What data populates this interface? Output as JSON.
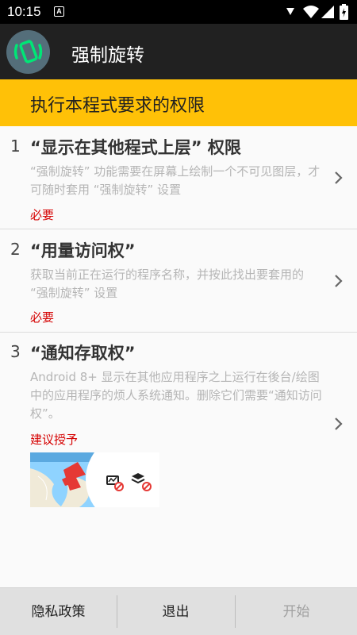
{
  "status_bar": {
    "time": "10:15",
    "notification_letter": "A"
  },
  "app_bar": {
    "title": "强制旋转",
    "icon": "rotate-phone-icon"
  },
  "banner": {
    "text": "执行本程式要求的权限"
  },
  "permissions": [
    {
      "number": "1",
      "title": "“显示在其他程式上层” 权限",
      "description": "“强制旋转” 功能需要在屏幕上绘制一个不可见图层，才可随时套用 “强制旋转” 设置",
      "tag": "必要"
    },
    {
      "number": "2",
      "title": "“用量访问权”",
      "description": "获取当前正在运行的程序名称，并按此找出要套用的 “强制旋转” 设置",
      "tag": "必要"
    },
    {
      "number": "3",
      "title": "“通知存取权”",
      "description": "Android 8+ 显示在其他应用程序之上运行在後台/绘图中的应用程序的烦人系统通知。删除它们需要“通知访问权”。",
      "tag": "建议授予"
    }
  ],
  "bottom_bar": {
    "privacy": "隐私政策",
    "exit": "退出",
    "start": "开始"
  },
  "colors": {
    "accent": "#ffc107",
    "app_bar": "#212121",
    "required": "#d50000",
    "icon_green": "#00e676"
  }
}
